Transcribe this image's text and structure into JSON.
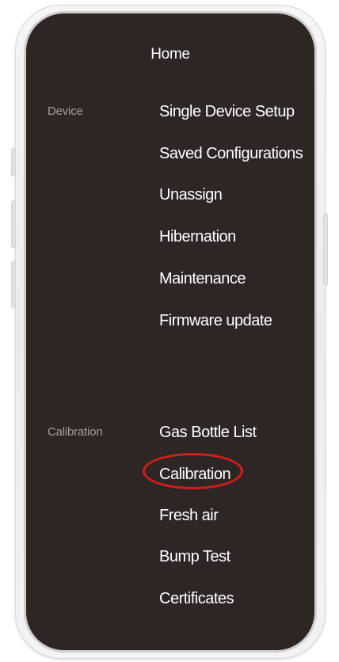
{
  "header": {
    "title": "Home"
  },
  "sections": {
    "device": {
      "label": "Device",
      "items": [
        "Single Device Setup",
        "Saved Configurations",
        "Unassign",
        "Hibernation",
        "Maintenance",
        "Firmware update"
      ]
    },
    "calibration": {
      "label": "Calibration",
      "items": [
        "Gas Bottle List",
        "Calibration",
        "Fresh air",
        "Bump Test",
        "Certificates"
      ]
    }
  },
  "highlight": {
    "item": "Calibration",
    "color": "#d41d1d"
  },
  "colors": {
    "screen_background": "#2d2624",
    "menu_text": "#ffffff",
    "section_label_text": "#a59e9b"
  }
}
